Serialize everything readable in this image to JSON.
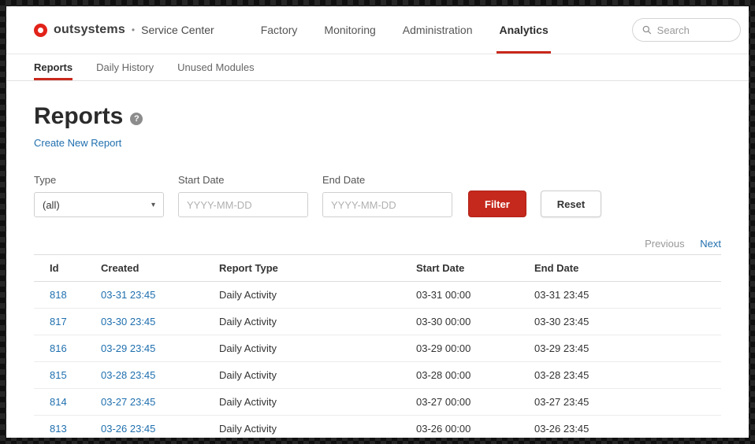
{
  "header": {
    "brand": "outsystems",
    "brand_dot": "•",
    "brand_suffix": "Service Center",
    "nav": [
      {
        "label": "Factory"
      },
      {
        "label": "Monitoring"
      },
      {
        "label": "Administration"
      },
      {
        "label": "Analytics",
        "active": true
      }
    ],
    "search_placeholder": "Search"
  },
  "tabs": [
    {
      "label": "Reports",
      "active": true
    },
    {
      "label": "Daily History"
    },
    {
      "label": "Unused Modules"
    }
  ],
  "page": {
    "title": "Reports",
    "help_glyph": "?",
    "create_link": "Create New Report"
  },
  "filters": {
    "type_label": "Type",
    "type_value": "(all)",
    "type_caret": "▾",
    "start_label": "Start Date",
    "start_placeholder": "YYYY-MM-DD",
    "end_label": "End Date",
    "end_placeholder": "YYYY-MM-DD",
    "filter_button": "Filter",
    "reset_button": "Reset"
  },
  "pagination": {
    "previous": "Previous",
    "next": "Next"
  },
  "table": {
    "columns": [
      "Id",
      "Created",
      "Report Type",
      "Start Date",
      "End Date"
    ],
    "rows": [
      [
        "818",
        "03-31 23:45",
        "Daily Activity",
        "03-31 00:00",
        "03-31 23:45"
      ],
      [
        "817",
        "03-30 23:45",
        "Daily Activity",
        "03-30 00:00",
        "03-30 23:45"
      ],
      [
        "816",
        "03-29 23:45",
        "Daily Activity",
        "03-29 00:00",
        "03-29 23:45"
      ],
      [
        "815",
        "03-28 23:45",
        "Daily Activity",
        "03-28 00:00",
        "03-28 23:45"
      ],
      [
        "814",
        "03-27 23:45",
        "Daily Activity",
        "03-27 00:00",
        "03-27 23:45"
      ],
      [
        "813",
        "03-26 23:45",
        "Daily Activity",
        "03-26 00:00",
        "03-26 23:45"
      ]
    ]
  },
  "colors": {
    "accent_red": "#c9281c",
    "logo_red": "#e2231a",
    "link_blue": "#1f6fae"
  }
}
